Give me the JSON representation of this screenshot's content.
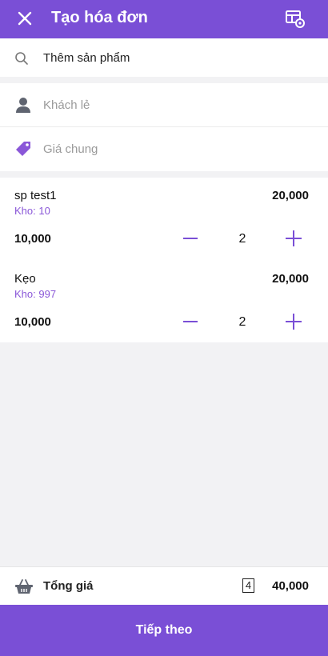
{
  "header": {
    "title": "Tạo hóa đơn",
    "icons": {
      "close": "close-icon",
      "view": "table-view-icon"
    },
    "background": "#7a4fd6"
  },
  "search": {
    "placeholder": "Thêm sản phẩm",
    "icon": "search-icon"
  },
  "customer": {
    "customer_label": "Khách lẻ",
    "price_list_label": "Giá chung",
    "icons": {
      "customer": "person-icon",
      "price": "price-tag-icon"
    }
  },
  "items": [
    {
      "name": "sp test1",
      "stock": "Kho: 10",
      "unit_price": "10,000",
      "quantity": "2",
      "line_total": "20,000"
    },
    {
      "name": "Kẹo",
      "stock": "Kho: 997",
      "unit_price": "10,000",
      "quantity": "2",
      "line_total": "20,000"
    }
  ],
  "summary": {
    "label": "Tổng giá",
    "item_count": "4",
    "total": "40,000",
    "icon": "basket-icon"
  },
  "action": {
    "next_label": "Tiếp theo"
  },
  "colors": {
    "accent": "#7a4fd6",
    "stock_text": "#8a57d8"
  }
}
